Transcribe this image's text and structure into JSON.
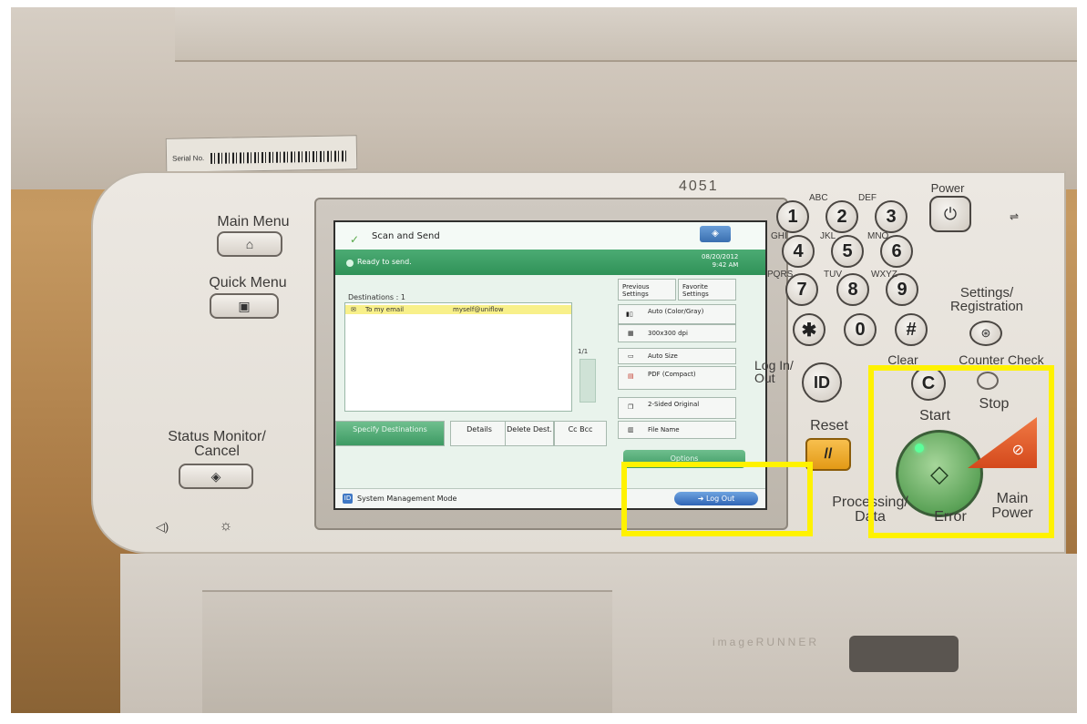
{
  "device": {
    "model": "4051",
    "brand_side": "imageRUNNER",
    "serial_label": "Serial No."
  },
  "panel_left": {
    "main_menu": "Main Menu",
    "quick_menu": "Quick Menu",
    "status_monitor": "Status Monitor/ Cancel"
  },
  "keypad": {
    "keys": [
      "1",
      "2",
      "3",
      "4",
      "5",
      "6",
      "7",
      "8",
      "9",
      "✱",
      "0",
      "#"
    ],
    "subs": [
      "ABC",
      "DEF",
      "GHI",
      "JKL",
      "MNO",
      "PQRS",
      "TUV",
      "WXYZ"
    ],
    "power": "Power",
    "settings": "Settings/ Registration",
    "log_in_out": "Log In/ Out",
    "id": "ID",
    "clear": "Clear",
    "clear_key": "C",
    "counter_check": "Counter Check",
    "reset": "Reset",
    "reset_key": "//",
    "start": "Start",
    "stop": "Stop",
    "processing": "Processing/ Data",
    "error": "Error",
    "main_power": "Main Power"
  },
  "screen": {
    "title": "Scan and Send",
    "status": "Ready to send.",
    "date": "08/20/2012",
    "time": "9:42 AM",
    "destinations_label": "Destinations : 1",
    "destination_row": {
      "name": "To my email",
      "address": "myself@uniflow"
    },
    "page": "1/1",
    "buttons": {
      "specify": "Specify Destinations",
      "details": "Details",
      "delete": "Delete Dest.",
      "cc_bcc": "Cc Bcc"
    },
    "right": {
      "previous_settings": "Previous Settings",
      "favorite_settings": "Favorite Settings",
      "color": "Auto (Color/Gray)",
      "resolution": "300x300 dpi",
      "size": "Auto Size",
      "format": "PDF (Compact)",
      "sided": "2-Sided Original",
      "file_name": "File Name",
      "options": "Options"
    },
    "mode": "System Management Mode",
    "logout": "Log Out"
  },
  "colors": {
    "highlight": "#fff200",
    "screen_green": "#3d9a63",
    "start_green": "#5ba257",
    "stop_orange": "#d4491c",
    "reset_yellow": "#e39a16"
  }
}
